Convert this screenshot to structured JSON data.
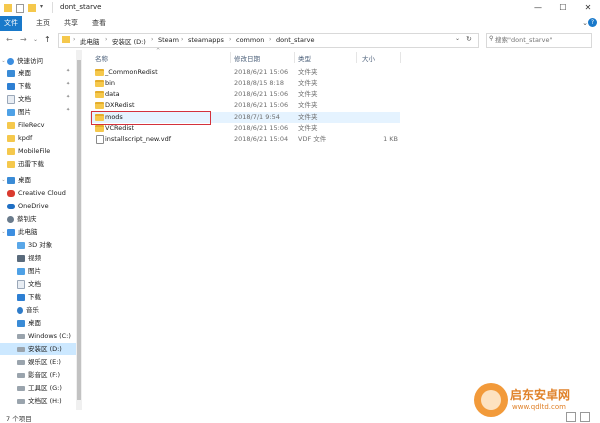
{
  "window": {
    "title": "dont_starve",
    "controls": {
      "minimize": "—",
      "maximize": "☐",
      "close": "✕"
    }
  },
  "ribbon": {
    "tabs": [
      "文件",
      "主页",
      "共享",
      "查看"
    ],
    "expand": "⌄",
    "help": "?"
  },
  "nav": {
    "back": "←",
    "forward": "→",
    "dropdown": "⌄",
    "up": "↑",
    "refresh": "↻"
  },
  "address": {
    "crumbs": [
      "此电脑",
      "安装区 (D:)",
      "Steam",
      "steamapps",
      "common",
      "dont_starve"
    ]
  },
  "search": {
    "placeholder": "搜索\"dont_starve\""
  },
  "sidebar": {
    "quick_access": "快速访问",
    "quick_items": [
      "桌面",
      "下载",
      "文档",
      "图片",
      "FileRecv",
      "kpdf",
      "MobileFile",
      "迅雷下载"
    ],
    "desktop": "桌面",
    "creative_cloud": "Creative Cloud",
    "onedrive": "OneDrive",
    "user": "蔡钊庆",
    "this_pc": "此电脑",
    "pc_items": [
      "3D 对象",
      "视频",
      "图片",
      "文档",
      "下载",
      "音乐",
      "桌面"
    ],
    "drives": [
      "Windows (C:)",
      "安装区 (D:)",
      "娱乐区 (E:)",
      "影音区 (F:)",
      "工具区 (G:)",
      "文档区 (H:)"
    ]
  },
  "columns": {
    "name": "名称",
    "date": "修改日期",
    "type": "类型",
    "size": "大小"
  },
  "files": [
    {
      "name": "_CommonRedist",
      "date": "2018/6/21 15:06",
      "type": "文件夹",
      "size": "",
      "kind": "folder"
    },
    {
      "name": "bin",
      "date": "2018/8/15 8:18",
      "type": "文件夹",
      "size": "",
      "kind": "folder"
    },
    {
      "name": "data",
      "date": "2018/6/21 15:06",
      "type": "文件夹",
      "size": "",
      "kind": "folder"
    },
    {
      "name": "DXRedist",
      "date": "2018/6/21 15:06",
      "type": "文件夹",
      "size": "",
      "kind": "folder"
    },
    {
      "name": "mods",
      "date": "2018/7/1 9:54",
      "type": "文件夹",
      "size": "",
      "kind": "folder"
    },
    {
      "name": "VCRedist",
      "date": "2018/6/21 15:06",
      "type": "文件夹",
      "size": "",
      "kind": "folder"
    },
    {
      "name": "installscript_new.vdf",
      "date": "2018/6/21 15:04",
      "type": "VDF 文件",
      "size": "1 KB",
      "kind": "file"
    }
  ],
  "status": {
    "count": "7 个项目"
  },
  "watermark": {
    "name": "启东安卓网",
    "url": "www.qdltd.com"
  }
}
